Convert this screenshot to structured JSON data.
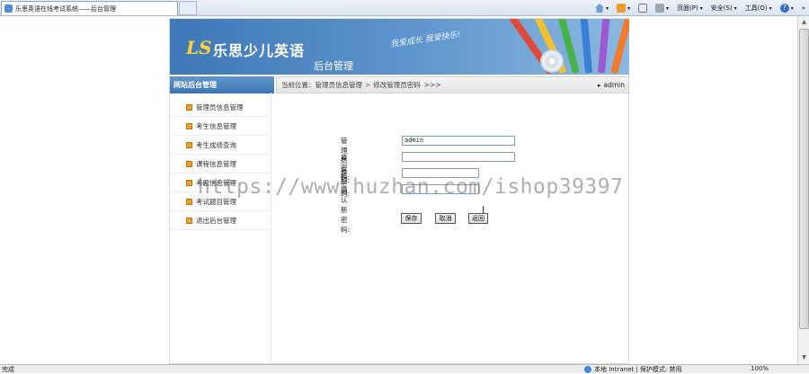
{
  "browser": {
    "tab_title": "乐思英语在线考试系统——后台管理",
    "menu": {
      "page": "页面(P)",
      "safety": "安全(S)",
      "tools": "工具(O)",
      "help": "?"
    },
    "more": "»"
  },
  "banner": {
    "logo_mark": "LS",
    "logo_text": "乐思少儿英语",
    "subtitle": "后台管理",
    "slogan": "我爱成长 我爱快乐!"
  },
  "sidebar": {
    "title": "网站后台管理",
    "items": [
      {
        "label": "管理员信息管理"
      },
      {
        "label": "考生信息管理"
      },
      {
        "label": "考生成绩查询"
      },
      {
        "label": "课程信息管理"
      },
      {
        "label": "考题信息管理"
      },
      {
        "label": "考试题目管理"
      },
      {
        "label": "退出后台管理"
      }
    ]
  },
  "breadcrumb": {
    "prefix": "当前位置：",
    "level1": "管理员信息管理",
    "sep": ">",
    "level2": "修改管理员密码",
    "suffix": ">>>",
    "user": "admin"
  },
  "form": {
    "username_label": "管理员名称:",
    "username_value": "admin",
    "old_password_label": "原密码:",
    "new_password_label": "新密码:",
    "confirm_password_label": "确认新密码:",
    "save_label": "保存",
    "cancel_label": "取消",
    "back_label": "返回"
  },
  "watermark": "https://www.huzhan.com/ishop39397",
  "statusbar": {
    "left": "完成",
    "zone": "本地 Intranet | 保护模式: 禁用",
    "zoom": "100%"
  },
  "colors": {
    "banner": "#4a84c2",
    "sidebar_head": "#4a82c0",
    "bullet": "#f0a21d"
  }
}
